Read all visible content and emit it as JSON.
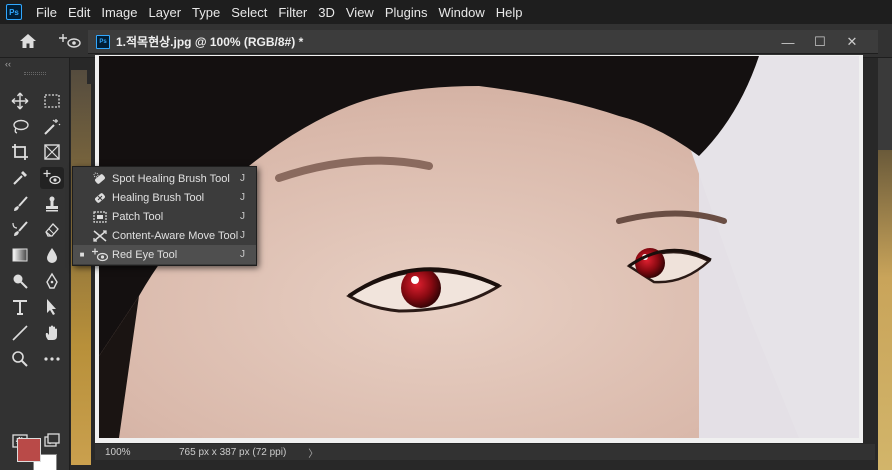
{
  "app": {
    "logo_text": "Ps"
  },
  "menu": [
    "File",
    "Edit",
    "Image",
    "Layer",
    "Type",
    "Select",
    "Filter",
    "3D",
    "View",
    "Plugins",
    "Window",
    "Help"
  ],
  "document": {
    "title": "1.적목현상.jpg @ 100% (RGB/8#) *",
    "zoom": "100%",
    "info": "765 px x 387 px (72 ppi)",
    "status_arrow": "〉"
  },
  "toolbar": {
    "collapse": "‹‹",
    "foreground_color": "#b94a48",
    "background_color": "#ffffff"
  },
  "flyout": {
    "items": [
      {
        "label": "Spot Healing Brush Tool",
        "key": "J",
        "icon": "spot-healing-brush-icon",
        "selected": false
      },
      {
        "label": "Healing Brush Tool",
        "key": "J",
        "icon": "healing-brush-icon",
        "selected": false
      },
      {
        "label": "Patch Tool",
        "key": "J",
        "icon": "patch-icon",
        "selected": false
      },
      {
        "label": "Content-Aware Move Tool",
        "key": "J",
        "icon": "content-aware-move-icon",
        "selected": false
      },
      {
        "label": "Red Eye Tool",
        "key": "J",
        "icon": "red-eye-icon",
        "selected": true,
        "marker": "■"
      }
    ]
  },
  "window_controls": {
    "minimize": "—",
    "maximize": "☐",
    "close": "✕"
  }
}
